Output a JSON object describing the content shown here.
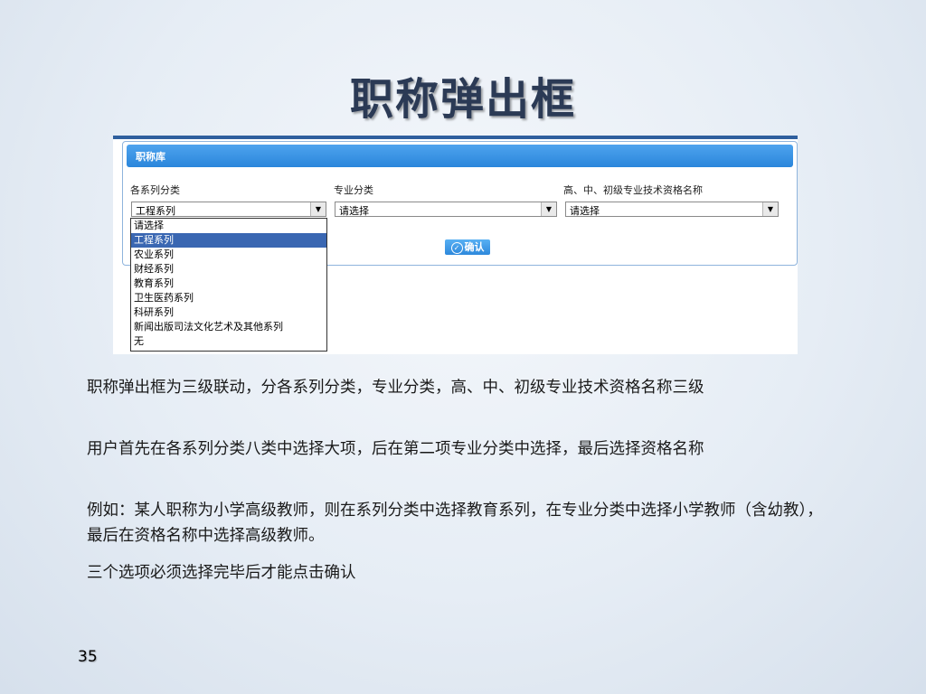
{
  "slide": {
    "title": "职称弹出框",
    "page_number": "35"
  },
  "screenshot": {
    "panel_title": "职称库",
    "fields": [
      {
        "label": "各系列分类",
        "value": "工程系列"
      },
      {
        "label": "专业分类",
        "value": "请选择"
      },
      {
        "label": "高、中、初级专业技术资格名称",
        "value": "请选择"
      }
    ],
    "confirm_label": "确认",
    "dropdown_options": [
      "请选择",
      "工程系列",
      "农业系列",
      "财经系列",
      "教育系列",
      "卫生医药系列",
      "科研系列",
      "新闻出版司法文化艺术及其他系列",
      "无"
    ],
    "dropdown_selected": "工程系列"
  },
  "description": [
    "职称弹出框为三级联动，分各系列分类，专业分类，高、中、初级专业技术资格名称三级",
    "用户首先在各系列分类八类中选择大项，后在第二项专业分类中选择，最后选择资格名称",
    "例如：某人职称为小学高级教师，则在系列分类中选择教育系列，在专业分类中选择小学教师（含幼教），最后在资格名称中选择高级教师。",
    "三个选项必须选择完毕后才能点击确认"
  ],
  "colors": {
    "header_blue": "#2a86db",
    "selected_option": "#3a67b2",
    "title_color": "#2b3a55"
  }
}
